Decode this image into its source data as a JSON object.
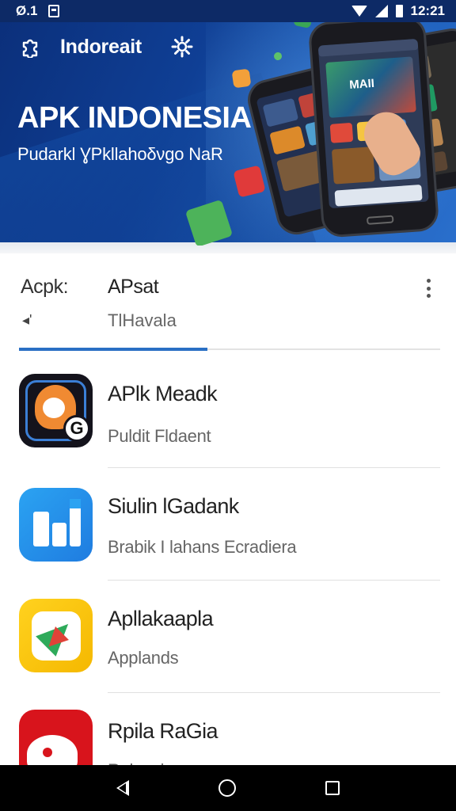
{
  "status_bar": {
    "left_text": "Ø.1",
    "time": "12:21",
    "icons": [
      "notification-icon",
      "wifi-icon",
      "signal-icon",
      "battery-icon"
    ]
  },
  "hero": {
    "brand": "Indoreait",
    "title": "APK INDONESIA",
    "subtitle": "Pudarkl ƔPkllahoδνgo ΝaR",
    "phone_screen_label": "MAII"
  },
  "tabs": [
    {
      "title": "Acpk:",
      "subtitle": "◂'"
    },
    {
      "title": "APsat",
      "subtitle": "TlHavala"
    }
  ],
  "apps": [
    {
      "title": "APlk Meadk",
      "subtitle": "Puldit Fldaent",
      "icon": "fox-app-icon"
    },
    {
      "title": "Siulin lGadank",
      "subtitle": "Brabik I lahans Ecradiera",
      "icon": "chart-app-icon"
    },
    {
      "title": "Apllakaapla",
      "subtitle": "Applands",
      "icon": "compass-app-icon"
    },
    {
      "title": "Rpila RaGia",
      "subtitle": "Rulansio",
      "icon": "robot-app-icon"
    }
  ],
  "colors": {
    "hero_dark": "#0b2f7a",
    "hero_light": "#2a6fcc",
    "tab_indicator": "#2a6fc4"
  }
}
